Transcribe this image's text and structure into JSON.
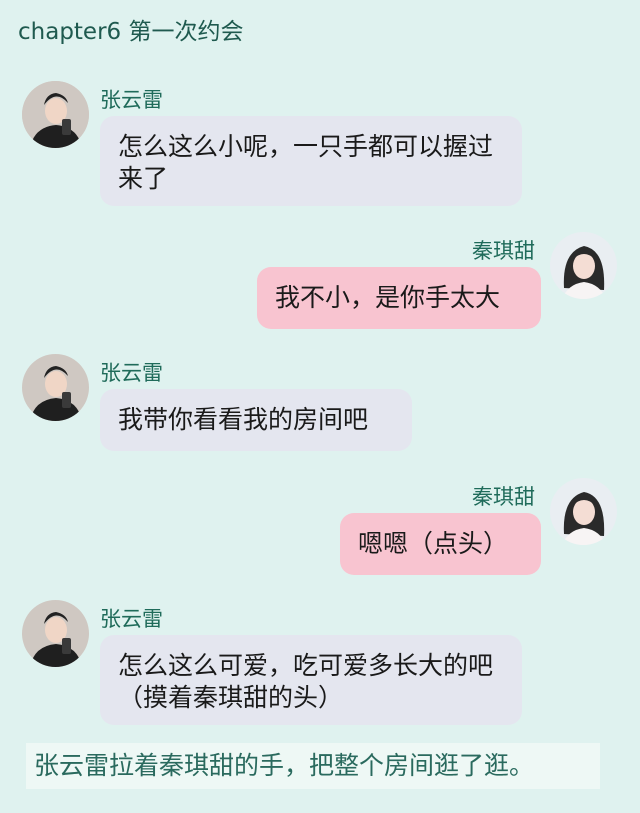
{
  "header": {
    "title": "chapter6 第一次约会"
  },
  "messages": [
    {
      "sender": "张云雷",
      "side": "left",
      "avatar": "male-avatar",
      "text": "怎么这么小呢，一只手都可以握过来了"
    },
    {
      "sender": "秦琪甜",
      "side": "right",
      "avatar": "female-avatar",
      "text": "我不小，是你手太大"
    },
    {
      "sender": "张云雷",
      "side": "left",
      "avatar": "male-avatar",
      "text": "我带你看看我的房间吧"
    },
    {
      "sender": "秦琪甜",
      "side": "right",
      "avatar": "female-avatar",
      "text": "嗯嗯（点头）"
    },
    {
      "sender": "张云雷",
      "side": "left",
      "avatar": "male-avatar",
      "text": "怎么这么可爱，吃可爱多长大的吧（摸着秦琪甜的头）"
    }
  ],
  "narration": "张云雷拉着秦琪甜的手，把整个房间逛了逛。",
  "colors": {
    "background": "#dff2ef",
    "left_bubble": "#e4e6ef",
    "right_bubble": "#f8c4d0",
    "name_text": "#1f6b5a"
  }
}
